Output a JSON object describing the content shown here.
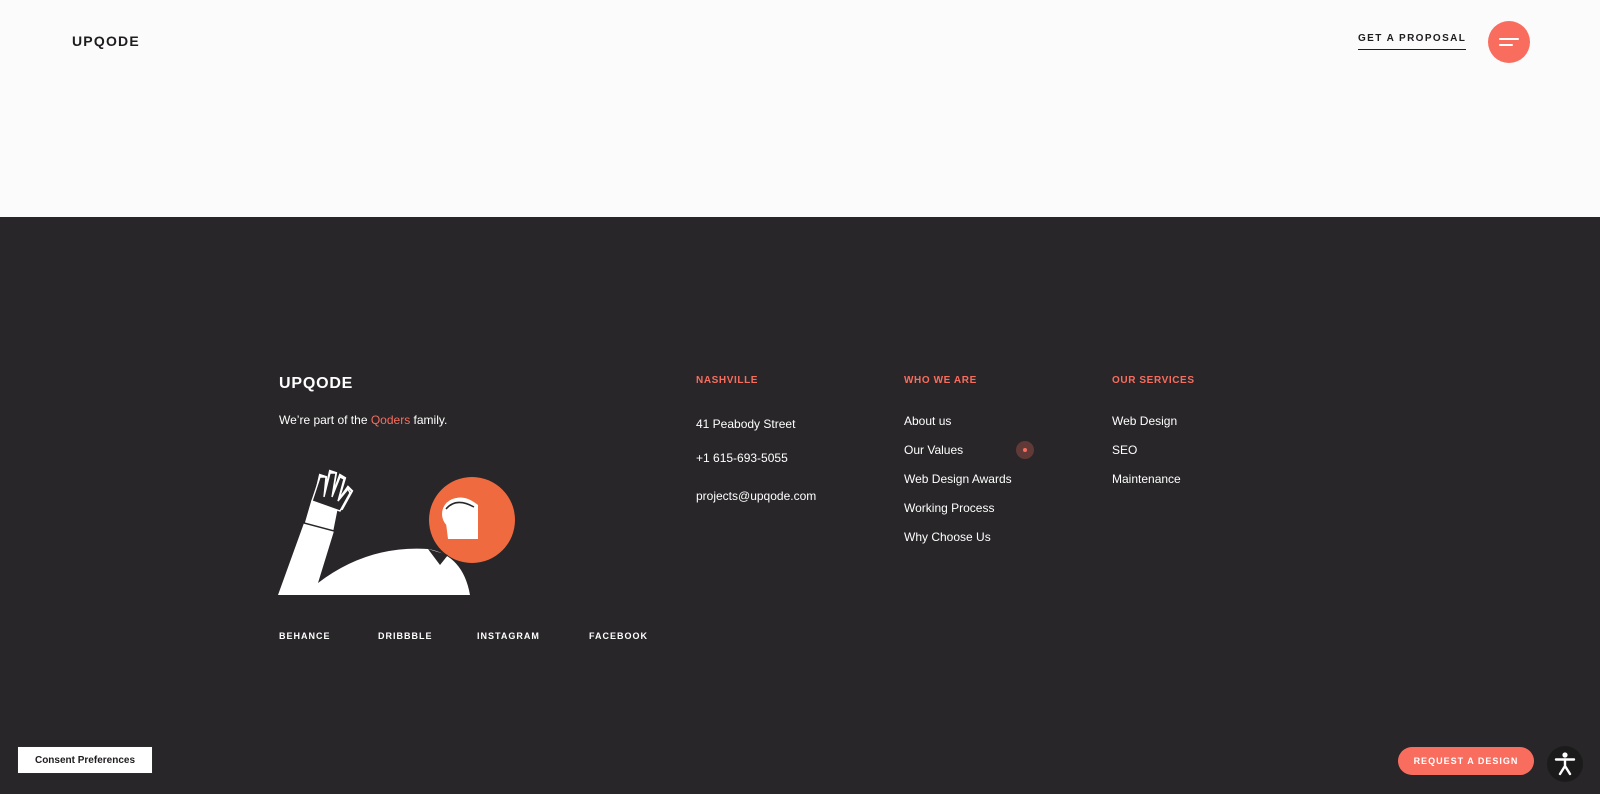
{
  "header": {
    "logo": "UPQODE",
    "proposal_label": "GET A PROPOSAL",
    "menu_icon": "hamburger-menu-icon"
  },
  "footer": {
    "logo": "UPQODE",
    "tagline_before": "We’re part of the",
    "tagline_link": "Qoders",
    "tagline_after": "family.",
    "illustration": "waving-person-illustration",
    "social": [
      "BEHANCE",
      "DRIBBBLE",
      "INSTAGRAM",
      "FACEBOOK"
    ],
    "nashville": {
      "heading": "NASHVILLE",
      "address": "41 Peabody Street",
      "phone": "+1 615-693-5055",
      "email": "projects@upqode.com"
    },
    "who_we_are": {
      "heading": "WHO WE ARE",
      "items": [
        "About us",
        "Our Values",
        "Web Design Awards",
        "Working Process",
        "Why Choose Us"
      ]
    },
    "our_services": {
      "heading": "OUR SERVICES",
      "items": [
        "Web Design",
        "SEO",
        "Maintenance"
      ]
    }
  },
  "widgets": {
    "consent_label": "Consent Preferences",
    "request_label": "REQUEST A DESIGN",
    "accessibility_icon": "accessibility-icon"
  },
  "colors": {
    "accent": "#f96d5f",
    "footer_bg": "#282628",
    "header_bg": "#fbfbfb",
    "text_dark": "#1e1c1e"
  }
}
